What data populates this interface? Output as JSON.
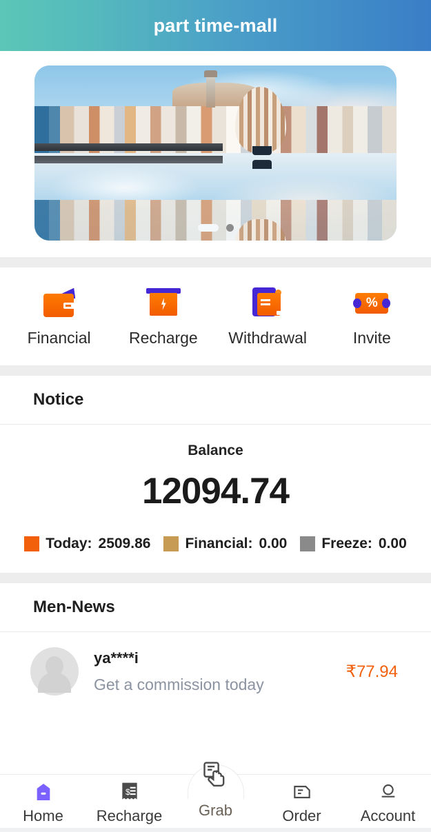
{
  "header": {
    "title": "part time-mall"
  },
  "banner": {
    "alt": "istanbul-skyline-mirrored-banner",
    "dots": [
      "active",
      "inactive"
    ]
  },
  "actions": [
    {
      "label": "Financial",
      "icon": "wallet-icon"
    },
    {
      "label": "Recharge",
      "icon": "recharge-icon"
    },
    {
      "label": "Withdrawal",
      "icon": "withdrawal-icon"
    },
    {
      "label": "Invite",
      "icon": "ticket-percent-icon"
    }
  ],
  "notice": {
    "title": "Notice"
  },
  "balance": {
    "label": "Balance",
    "value": "12094.74",
    "legend": [
      {
        "label": "Today:",
        "value": "2509.86",
        "color": "#f2600c"
      },
      {
        "label": "Financial:",
        "value": "0.00",
        "color": "#c89b55"
      },
      {
        "label": "Freeze:",
        "value": "0.00",
        "color": "#8a8a8a"
      }
    ]
  },
  "news": {
    "title": "Men-News",
    "items": [
      {
        "name": "ya****i",
        "subtitle": "Get a commission today",
        "amount": "₹77.94"
      }
    ]
  },
  "tabbar": [
    {
      "label": "Home",
      "icon": "home-icon",
      "active": true
    },
    {
      "label": "Recharge",
      "icon": "receipt-dollar-icon",
      "active": false
    },
    {
      "label": "Grab",
      "icon": "hand-tap-icon",
      "active": false
    },
    {
      "label": "Order",
      "icon": "order-doc-icon",
      "active": false
    },
    {
      "label": "Account",
      "icon": "person-circle-icon",
      "active": false
    }
  ],
  "colors": {
    "header_gradient_start": "#5cc6b7",
    "header_gradient_end": "#3a7ec7",
    "accent_orange": "#f2600c",
    "accent_purple": "#7b61ff",
    "band_gray": "#ededed"
  }
}
